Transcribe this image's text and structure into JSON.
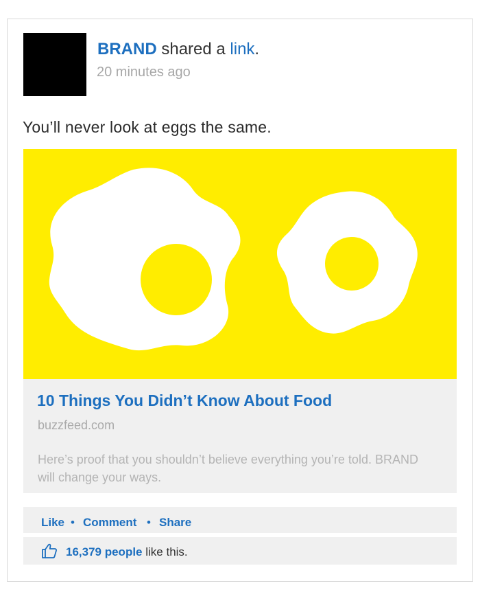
{
  "post": {
    "brand": "BRAND",
    "shared_text": " shared a ",
    "link_word": "link",
    "period": ".",
    "timestamp": "20 minutes ago",
    "status": "You’ll never look at eggs the same."
  },
  "preview": {
    "title": "10 Things You Didn’t Know About Food",
    "domain": "buzzfeed.com",
    "description": "Here’s proof that you shouldn’t believe everything you’re told. BRAND will change your ways."
  },
  "actions": {
    "like": "Like",
    "comment": "Comment",
    "share": "Share",
    "separator": "•"
  },
  "likes": {
    "count_text": "16,379 people",
    "suffix": " like this."
  },
  "colors": {
    "link_blue": "#1d6fbf",
    "hero_yellow": "#ffed00",
    "panel_gray": "#f0f0f0"
  },
  "icons": {
    "like": "thumbs-up-icon"
  }
}
